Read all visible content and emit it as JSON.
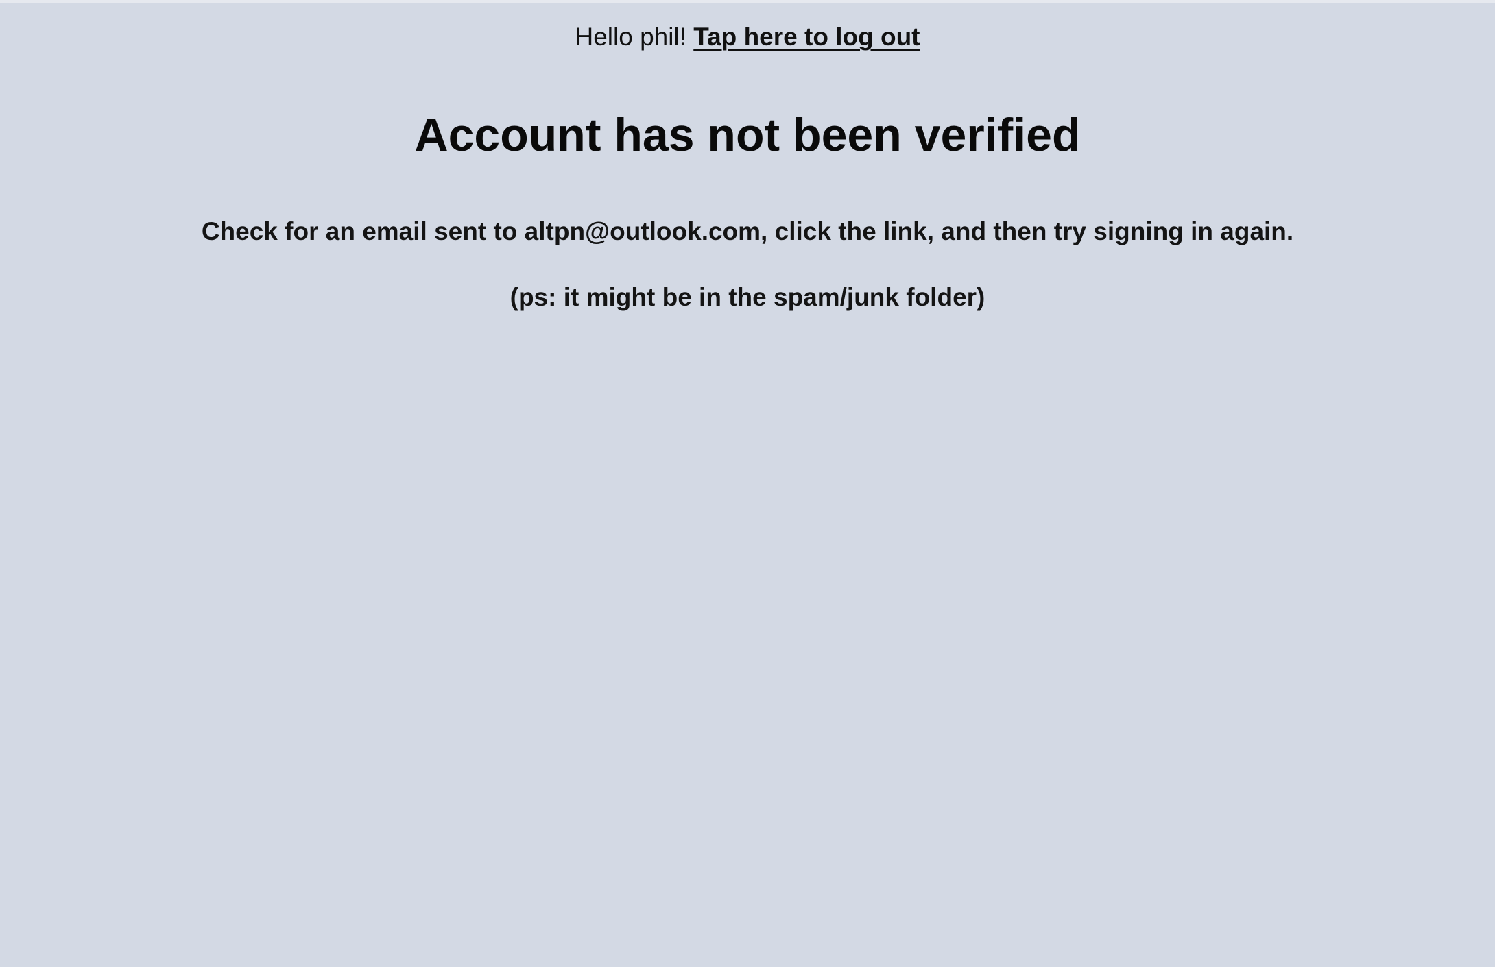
{
  "header": {
    "greeting": "Hello phil!",
    "logout_label": "Tap here to log out"
  },
  "main": {
    "title": "Account has not been verified",
    "message": "Check for an email sent to altpn@outlook.com, click the link, and then try signing in again.",
    "note": "(ps: it might be in the spam/junk folder)"
  },
  "colors": {
    "background": "#d3d9e4",
    "text": "#0d0d0d"
  }
}
